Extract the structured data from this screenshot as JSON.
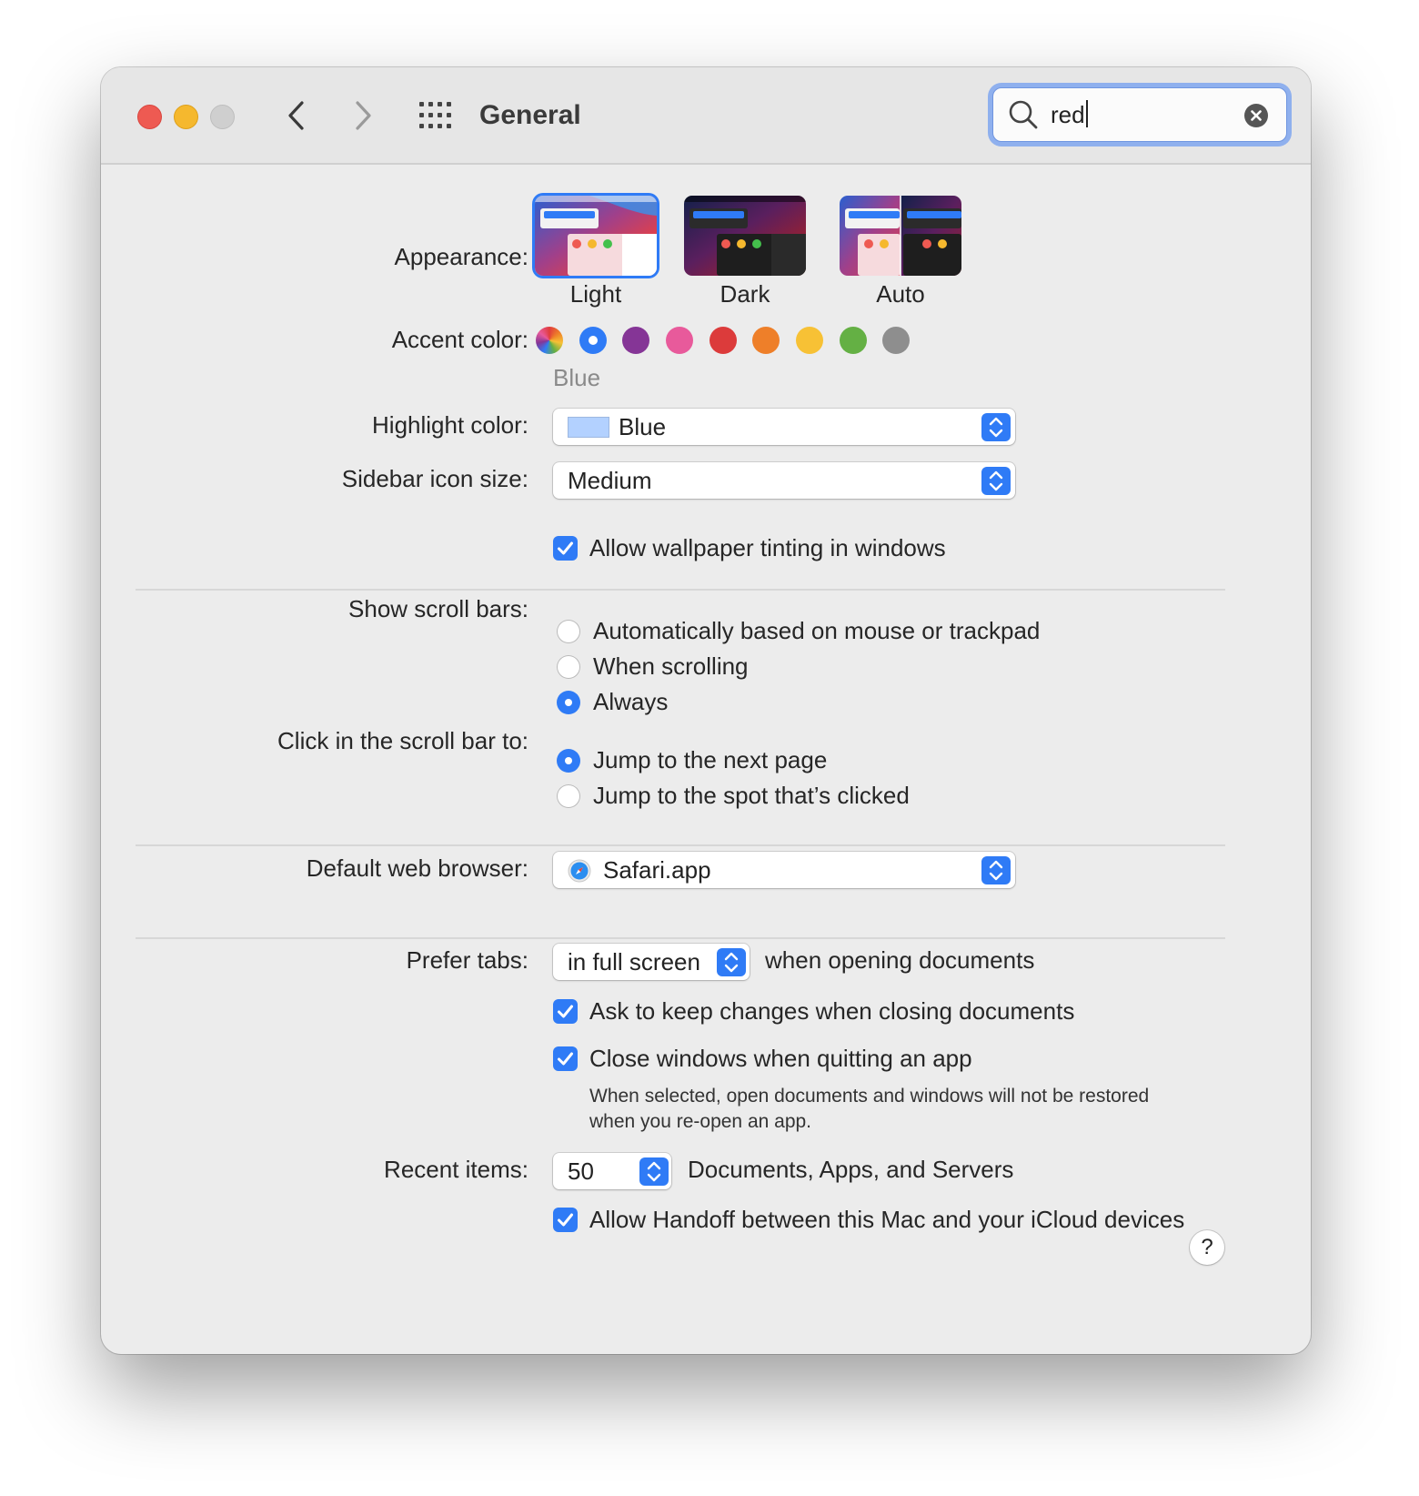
{
  "window": {
    "title": "General",
    "search": {
      "value": "red",
      "placeholder": "Search"
    }
  },
  "appearance": {
    "label": "Appearance:",
    "options": [
      "Light",
      "Dark",
      "Auto"
    ],
    "selected": "Light"
  },
  "accent": {
    "label": "Accent color:",
    "selected_name": "Blue",
    "colors": [
      "multicolor",
      "#2f7bf6",
      "#853596",
      "#e85a9b",
      "#dc3b3b",
      "#ee7f29",
      "#f7c135",
      "#64b044",
      "#8e8e8e"
    ]
  },
  "highlight": {
    "label": "Highlight color:",
    "value": "Blue",
    "swatch_color": "#b3d1ff"
  },
  "sidebar_icon_size": {
    "label": "Sidebar icon size:",
    "value": "Medium"
  },
  "wallpaper_tinting": {
    "label": "Allow wallpaper tinting in windows",
    "checked": true
  },
  "scroll_bars": {
    "label": "Show scroll bars:",
    "options": [
      "Automatically based on mouse or trackpad",
      "When scrolling",
      "Always"
    ],
    "selected": "Always"
  },
  "click_scroll_bar": {
    "label": "Click in the scroll bar to:",
    "options": [
      "Jump to the next page",
      "Jump to the spot that’s clicked"
    ],
    "selected": "Jump to the next page"
  },
  "default_browser": {
    "label": "Default web browser:",
    "value": "Safari.app"
  },
  "prefer_tabs": {
    "label": "Prefer tabs:",
    "value": "in full screen",
    "suffix": "when opening documents"
  },
  "ask_keep_changes": {
    "label": "Ask to keep changes when closing documents",
    "checked": true
  },
  "close_windows": {
    "label": "Close windows when quitting an app",
    "checked": true,
    "note_line1": "When selected, open documents and windows will not be restored",
    "note_line2": "when you re-open an app."
  },
  "recent_items": {
    "label": "Recent items:",
    "value": "50",
    "suffix": "Documents, Apps, and Servers"
  },
  "handoff": {
    "label": "Allow Handoff between this Mac and your iCloud devices",
    "checked": true
  },
  "help": {
    "label": "?"
  }
}
